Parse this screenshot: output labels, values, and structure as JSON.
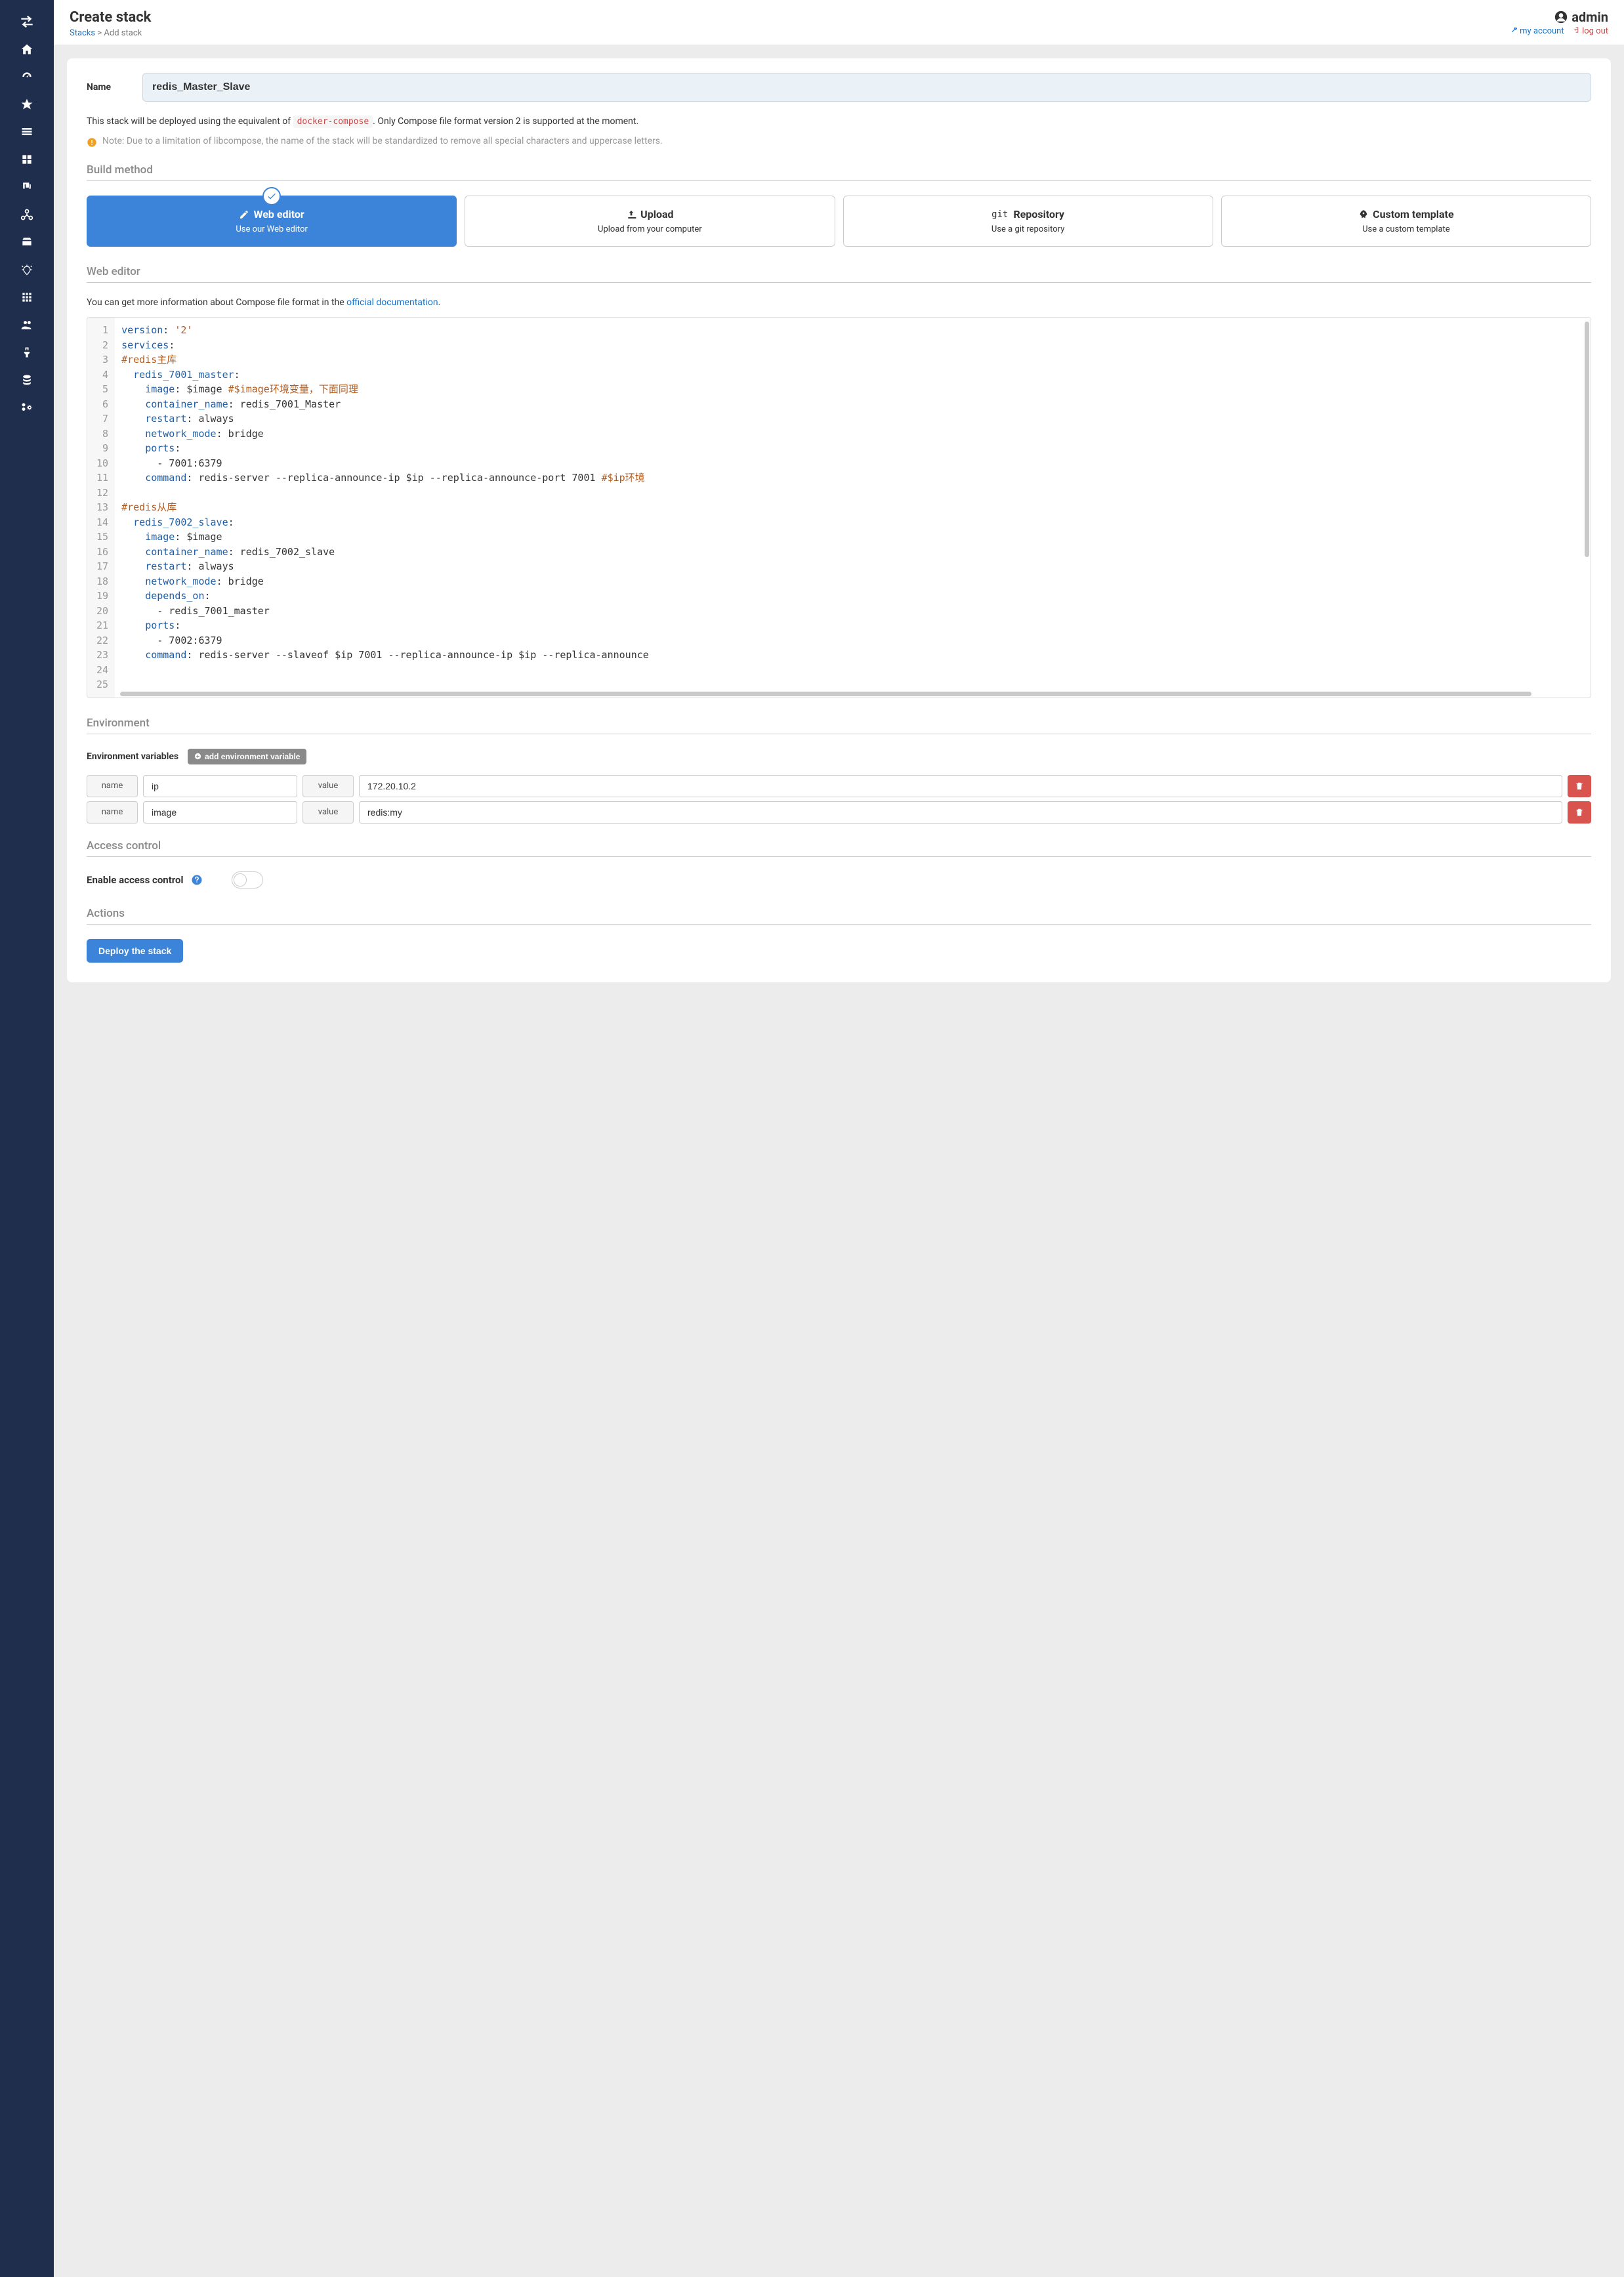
{
  "header": {
    "title": "Create stack",
    "breadcrumb_link": "Stacks",
    "breadcrumb_current": "Add stack",
    "username": "admin",
    "my_account": "my account",
    "log_out": "log out"
  },
  "form": {
    "name_label": "Name",
    "name_value": "redis_Master_Slave",
    "intro_pre": "This stack will be deployed using the equivalent of ",
    "intro_code": "docker-compose",
    "intro_post": ". Only Compose file format version 2 is supported at the moment.",
    "note": "Note: Due to a limitation of libcompose, the name of the stack will be standardized to remove all special characters and uppercase letters."
  },
  "sections": {
    "build_method": "Build method",
    "web_editor": "Web editor",
    "environment": "Environment",
    "access_control": "Access control",
    "actions": "Actions"
  },
  "methods": [
    {
      "title": "Web editor",
      "subtitle": "Use our Web editor",
      "active": true,
      "icon": "edit"
    },
    {
      "title": "Upload",
      "subtitle": "Upload from your computer",
      "active": false,
      "icon": "upload"
    },
    {
      "title": "Repository",
      "subtitle": "Use a git repository",
      "active": false,
      "icon": "git"
    },
    {
      "title": "Custom template",
      "subtitle": "Use a custom template",
      "active": false,
      "icon": "rocket"
    }
  ],
  "editor_hint_pre": "You can get more information about Compose file format in the ",
  "editor_hint_link": "official documentation",
  "code_lines": [
    [
      {
        "t": "key",
        "v": "version"
      },
      {
        "t": "plain",
        "v": ": "
      },
      {
        "t": "str",
        "v": "'2'"
      }
    ],
    [
      {
        "t": "key",
        "v": "services"
      },
      {
        "t": "plain",
        "v": ":"
      }
    ],
    [
      {
        "t": "comment",
        "v": "#redis主库"
      }
    ],
    [
      {
        "t": "plain",
        "v": "  "
      },
      {
        "t": "key",
        "v": "redis_7001_master"
      },
      {
        "t": "plain",
        "v": ":"
      }
    ],
    [
      {
        "t": "plain",
        "v": "    "
      },
      {
        "t": "key",
        "v": "image"
      },
      {
        "t": "plain",
        "v": ": $image "
      },
      {
        "t": "comment",
        "v": "#$image环境变量，下面同理"
      }
    ],
    [
      {
        "t": "plain",
        "v": "    "
      },
      {
        "t": "key",
        "v": "container_name"
      },
      {
        "t": "plain",
        "v": ": redis_7001_Master"
      }
    ],
    [
      {
        "t": "plain",
        "v": "    "
      },
      {
        "t": "key",
        "v": "restart"
      },
      {
        "t": "plain",
        "v": ": always"
      }
    ],
    [
      {
        "t": "plain",
        "v": "    "
      },
      {
        "t": "key",
        "v": "network_mode"
      },
      {
        "t": "plain",
        "v": ": bridge"
      }
    ],
    [
      {
        "t": "plain",
        "v": "    "
      },
      {
        "t": "key",
        "v": "ports"
      },
      {
        "t": "plain",
        "v": ":"
      }
    ],
    [
      {
        "t": "plain",
        "v": "      - 7001:6379"
      }
    ],
    [
      {
        "t": "plain",
        "v": "    "
      },
      {
        "t": "key",
        "v": "command"
      },
      {
        "t": "plain",
        "v": ": redis-server --replica-announce-ip $ip --replica-announce-port 7001 "
      },
      {
        "t": "comment",
        "v": "#$ip环境"
      }
    ],
    [],
    [
      {
        "t": "comment",
        "v": "#redis从库"
      }
    ],
    [
      {
        "t": "plain",
        "v": "  "
      },
      {
        "t": "key",
        "v": "redis_7002_slave"
      },
      {
        "t": "plain",
        "v": ":"
      }
    ],
    [
      {
        "t": "plain",
        "v": "    "
      },
      {
        "t": "key",
        "v": "image"
      },
      {
        "t": "plain",
        "v": ": $image"
      }
    ],
    [
      {
        "t": "plain",
        "v": "    "
      },
      {
        "t": "key",
        "v": "container_name"
      },
      {
        "t": "plain",
        "v": ": redis_7002_slave"
      }
    ],
    [
      {
        "t": "plain",
        "v": "    "
      },
      {
        "t": "key",
        "v": "restart"
      },
      {
        "t": "plain",
        "v": ": always"
      }
    ],
    [
      {
        "t": "plain",
        "v": "    "
      },
      {
        "t": "key",
        "v": "network_mode"
      },
      {
        "t": "plain",
        "v": ": bridge"
      }
    ],
    [
      {
        "t": "plain",
        "v": "    "
      },
      {
        "t": "key",
        "v": "depends_on"
      },
      {
        "t": "plain",
        "v": ":"
      }
    ],
    [
      {
        "t": "plain",
        "v": "      - redis_7001_master"
      }
    ],
    [
      {
        "t": "plain",
        "v": "    "
      },
      {
        "t": "key",
        "v": "ports"
      },
      {
        "t": "plain",
        "v": ":"
      }
    ],
    [
      {
        "t": "plain",
        "v": "      - 7002:6379"
      }
    ],
    [
      {
        "t": "plain",
        "v": "    "
      },
      {
        "t": "key",
        "v": "command"
      },
      {
        "t": "plain",
        "v": ": redis-server --slaveof $ip 7001 --replica-announce-ip $ip --replica-announce"
      }
    ],
    [],
    []
  ],
  "env": {
    "label": "Environment variables",
    "add_button": "add environment variable",
    "col_name": "name",
    "col_value": "value",
    "vars": [
      {
        "name": "ip",
        "value": "172.20.10.2"
      },
      {
        "name": "image",
        "value": "redis:my"
      }
    ]
  },
  "access": {
    "label": "Enable access control",
    "enabled": false
  },
  "actions": {
    "deploy": "Deploy the stack"
  }
}
